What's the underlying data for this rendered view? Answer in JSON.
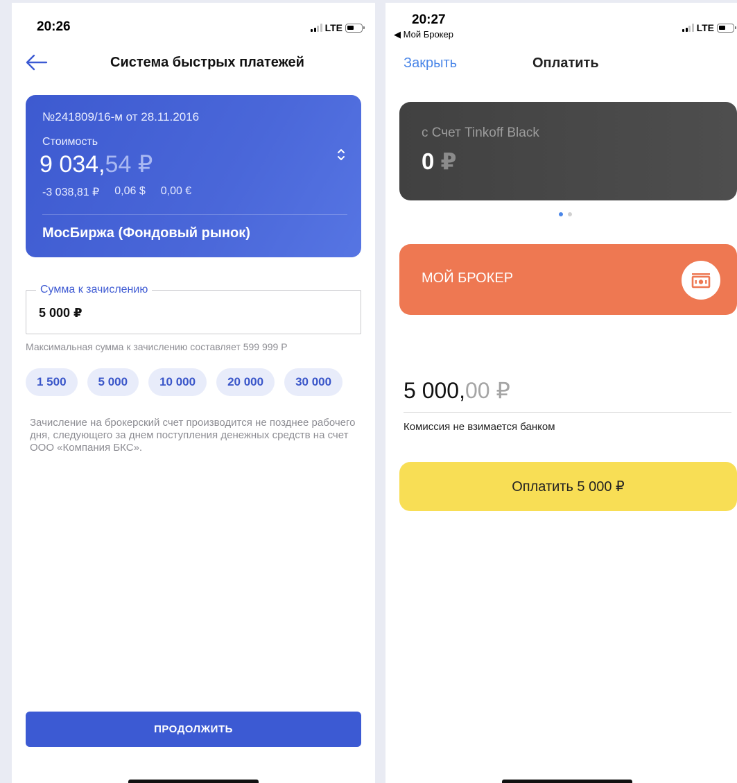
{
  "left": {
    "status": {
      "time": "20:26",
      "network": "LTE"
    },
    "header": {
      "title": "Система быстрых платежей",
      "back_icon": "arrow-left-icon"
    },
    "account_card": {
      "contract": "№241809/16-м от 28.11.2016",
      "cost_label": "Стоимость",
      "amount_int": "9 034,",
      "amount_frac": "54 ₽",
      "balances": [
        "-3 038,81 ₽",
        "0,06 $",
        "0,00 €"
      ],
      "exchange": "МосБиржа (Фондовый рынок)",
      "chevron_icon": "chevron-up-down-icon"
    },
    "amount_field": {
      "label": "Сумма к зачислению",
      "value": "5 000 ₽",
      "hint": "Максимальная сумма к зачислению составляет 599 999 Р"
    },
    "chips": [
      "1 500",
      "5 000",
      "10 000",
      "20 000",
      "30 000"
    ],
    "note": "Зачисление на брокерский счет производится не позднее рабочего дня, следующего за днем поступления денежных средств на счет ООО «Компания БКС».",
    "continue_label": "ПРОДОЛЖИТЬ"
  },
  "right": {
    "status": {
      "time": "20:27",
      "back_app": "◀ Мой Брокер",
      "network": "LTE"
    },
    "header": {
      "close_label": "Закрыть",
      "title": "Оплатить"
    },
    "source_card": {
      "label": "с Счет Tinkoff Black",
      "amount": "0",
      "currency": "₽"
    },
    "pager": {
      "pages": 2,
      "active": 0
    },
    "dest_card": {
      "label": "МОЙ БРОКЕР",
      "icon": "banknote-icon"
    },
    "amount_int": "5 000,",
    "amount_frac": "00 ₽",
    "commission": "Комиссия не взимается банком",
    "pay_label": "Оплатить 5 000 ₽",
    "colors": {
      "accent_blue": "#4a86e8",
      "dark_card": "#454545",
      "orange_card": "#ee7852",
      "pay_button": "#f8de55"
    }
  }
}
